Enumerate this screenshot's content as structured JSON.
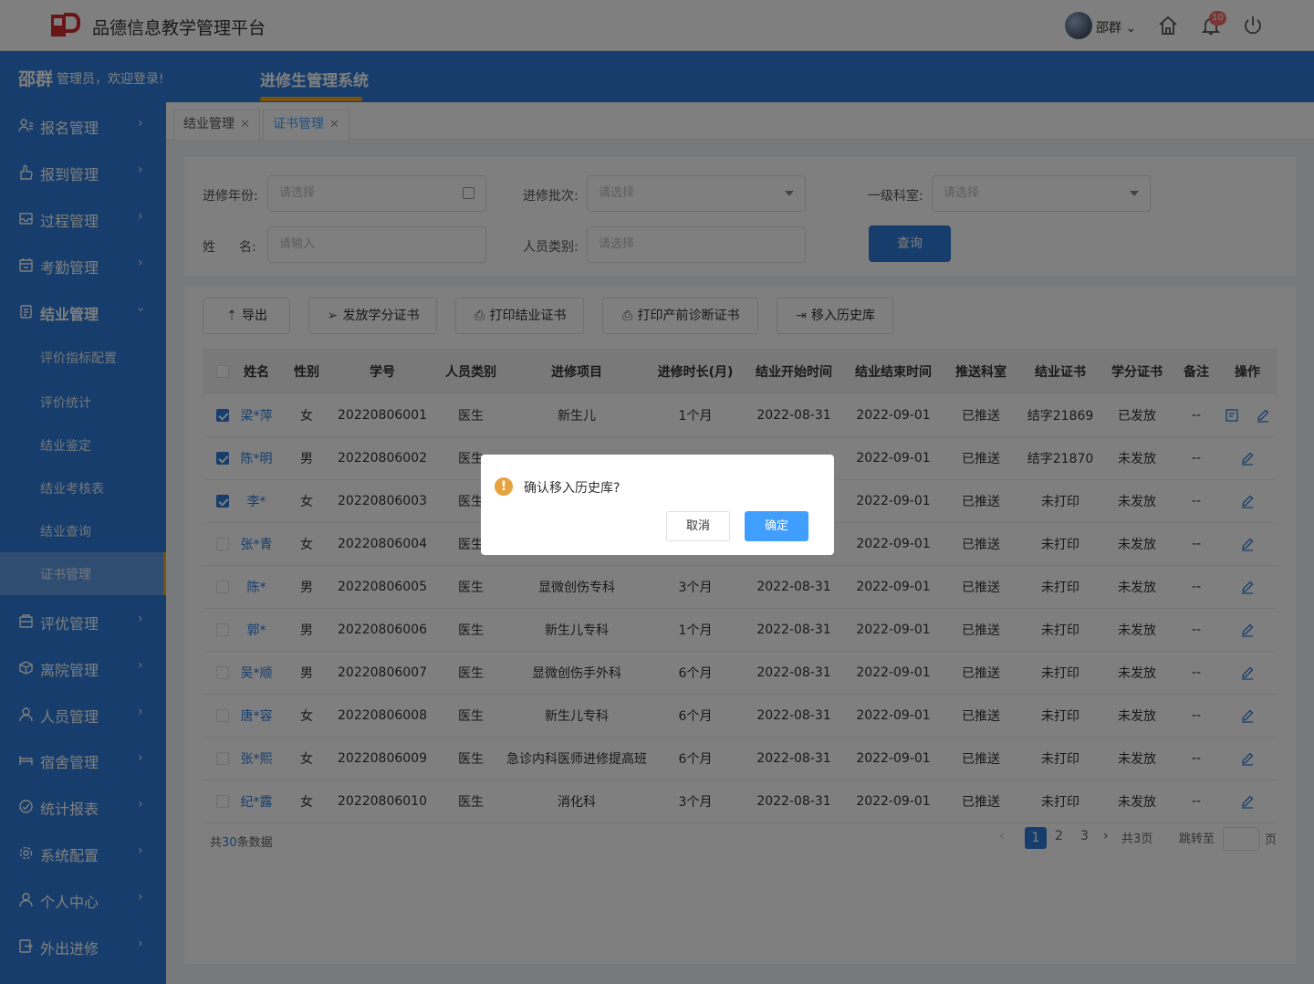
{
  "app": {
    "title": "品德信息教学管理平台",
    "user": "邵群",
    "notif_count": "10"
  },
  "welcome": {
    "name": "邵群",
    "text": "管理员，欢迎登录!"
  },
  "system_tab": "进修生管理系统",
  "sidebar": {
    "items": [
      {
        "label": "报名管理",
        "icon": "user-list-icon"
      },
      {
        "label": "报到管理",
        "icon": "hand-icon"
      },
      {
        "label": "过程管理",
        "icon": "tray-icon"
      },
      {
        "label": "考勤管理",
        "icon": "calendar-icon"
      },
      {
        "label": "结业管理",
        "icon": "document-icon"
      }
    ],
    "sub_items": [
      "评价指标配置",
      "评价统计",
      "结业鉴定",
      "结业考核表",
      "结业查询",
      "证书管理"
    ],
    "items2": [
      {
        "label": "评优管理",
        "icon": "award-icon"
      },
      {
        "label": "离院管理",
        "icon": "box-icon"
      },
      {
        "label": "人员管理",
        "icon": "person-icon"
      },
      {
        "label": "宿舍管理",
        "icon": "bed-icon"
      },
      {
        "label": "统计报表",
        "icon": "chart-icon"
      },
      {
        "label": "系统配置",
        "icon": "gear-icon"
      },
      {
        "label": "个人中心",
        "icon": "person-icon"
      },
      {
        "label": "外出进修",
        "icon": "exit-icon"
      }
    ]
  },
  "page_tabs": [
    {
      "label": "结业管理"
    },
    {
      "label": "证书管理"
    }
  ],
  "filters": {
    "year_label": "进修年份:",
    "year_placeholder": "请选择",
    "batch_label": "进修批次:",
    "batch_placeholder": "请选择",
    "dept_label": "一级科室:",
    "dept_placeholder": "请选择",
    "name_label_1": "姓",
    "name_label_2": "名:",
    "name_placeholder": "请输入",
    "type_label": "人员类别:",
    "type_placeholder": "请选择",
    "query": "查询"
  },
  "toolbar": {
    "export": "导出",
    "issue": "发放学分证书",
    "print_grad": "打印结业证书",
    "print_prenatal": "打印产前诊断证书",
    "move_history": "移入历史库"
  },
  "table": {
    "headers": [
      "姓名",
      "性别",
      "学号",
      "人员类别",
      "进修项目",
      "进修时长(月)",
      "结业开始时间",
      "结业结束时间",
      "推送科室",
      "结业证书",
      "学分证书",
      "备注",
      "操作"
    ],
    "rows": [
      {
        "checked": true,
        "cells": [
          "梁*萍",
          "女",
          "20220806001",
          "医生",
          "新生儿",
          "1个月",
          "2022-08-31",
          "2022-09-01",
          "已推送",
          "结字21869",
          "已发放",
          "--"
        ],
        "extra_icon": true
      },
      {
        "checked": true,
        "cells": [
          "陈*明",
          "男",
          "20220806002",
          "医生",
          "",
          "",
          "",
          "2022-09-01",
          "已推送",
          "结字21870",
          "未发放",
          "--"
        ],
        "extra_icon": false
      },
      {
        "checked": true,
        "cells": [
          "李*",
          "女",
          "20220806003",
          "医生",
          "",
          "",
          "",
          "2022-09-01",
          "已推送",
          "未打印",
          "未发放",
          "--"
        ],
        "extra_icon": false
      },
      {
        "checked": false,
        "cells": [
          "张*青",
          "女",
          "20220806004",
          "医生",
          "",
          "",
          "",
          "2022-09-01",
          "已推送",
          "未打印",
          "未发放",
          "--"
        ],
        "extra_icon": false
      },
      {
        "checked": false,
        "cells": [
          "陈*",
          "男",
          "20220806005",
          "医生",
          "显微创伤专科",
          "3个月",
          "2022-08-31",
          "2022-09-01",
          "已推送",
          "未打印",
          "未发放",
          "--"
        ],
        "extra_icon": false
      },
      {
        "checked": false,
        "cells": [
          "郭*",
          "男",
          "20220806006",
          "医生",
          "新生儿专科",
          "1个月",
          "2022-08-31",
          "2022-09-01",
          "已推送",
          "未打印",
          "未发放",
          "--"
        ],
        "extra_icon": false
      },
      {
        "checked": false,
        "cells": [
          "吴*顺",
          "男",
          "20220806007",
          "医生",
          "显微创伤手外科",
          "6个月",
          "2022-08-31",
          "2022-09-01",
          "已推送",
          "未打印",
          "未发放",
          "--"
        ],
        "extra_icon": false
      },
      {
        "checked": false,
        "cells": [
          "唐*容",
          "女",
          "20220806008",
          "医生",
          "新生儿专科",
          "6个月",
          "2022-08-31",
          "2022-09-01",
          "已推送",
          "未打印",
          "未发放",
          "--"
        ],
        "extra_icon": false
      },
      {
        "checked": false,
        "cells": [
          "张*熙",
          "女",
          "20220806009",
          "医生",
          "急诊内科医师进修提高班",
          "6个月",
          "2022-08-31",
          "2022-09-01",
          "已推送",
          "未打印",
          "未发放",
          "--"
        ],
        "extra_icon": false
      },
      {
        "checked": false,
        "cells": [
          "纪*露",
          "女",
          "20220806010",
          "医生",
          "消化科",
          "3个月",
          "2022-08-31",
          "2022-09-01",
          "已推送",
          "未打印",
          "未发放",
          "--"
        ],
        "extra_icon": false
      }
    ]
  },
  "pagination": {
    "total_prefix": "共",
    "total": "30",
    "total_suffix": "条数据",
    "pages": [
      "1",
      "2",
      "3"
    ],
    "page_count": "共3页",
    "jump": "跳转至",
    "page_unit": "页"
  },
  "dialog": {
    "message": "确认移入历史库?",
    "cancel": "取消",
    "confirm": "确定"
  },
  "colors": {
    "primary": "#2d7ad6",
    "accent": "#f5a623",
    "logo": "#d42b2b"
  }
}
